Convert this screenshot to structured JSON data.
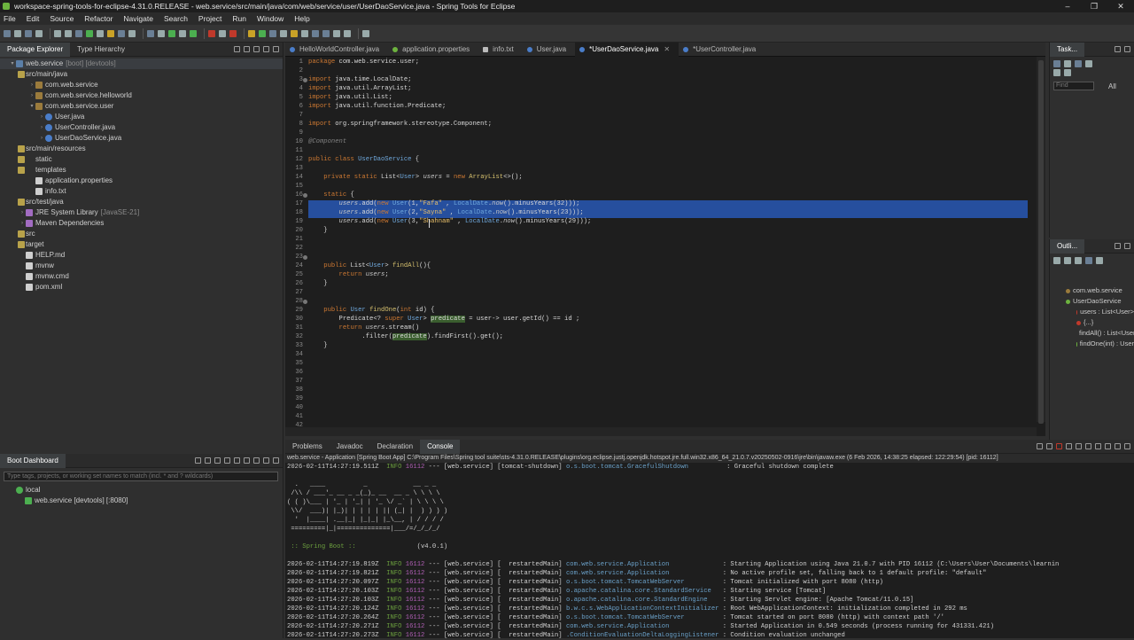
{
  "window": {
    "title": "workspace-spring-tools-for-eclipse-4.31.0.RELEASE - web.service/src/main/java/com/web/service/user/UserDaoService.java - Spring Tools for Eclipse",
    "controls": [
      "–",
      "❐",
      "✕"
    ]
  },
  "menu": [
    "File",
    "Edit",
    "Source",
    "Refactor",
    "Navigate",
    "Search",
    "Project",
    "Run",
    "Window",
    "Help"
  ],
  "package_explorer": {
    "tabs": [
      "Package Explorer",
      "Type Hierarchy"
    ],
    "items": [
      {
        "label": "web.service",
        "deco": "[boot] [devtools]",
        "icon": "proj",
        "indent": 0,
        "tw": "▾"
      },
      {
        "label": "src/main/java",
        "deco": "",
        "icon": "fold",
        "indent": 1,
        "tw": "▾"
      },
      {
        "label": "com.web.service",
        "deco": "",
        "icon": "pkg",
        "indent": 2,
        "tw": "›"
      },
      {
        "label": "com.web.service.helloworld",
        "deco": "",
        "icon": "pkg",
        "indent": 2,
        "tw": "›"
      },
      {
        "label": "com.web.service.user",
        "deco": "",
        "icon": "pkg",
        "indent": 2,
        "tw": "▾"
      },
      {
        "label": "User.java",
        "deco": "",
        "icon": "java",
        "indent": 3,
        "tw": "›"
      },
      {
        "label": "UserController.java",
        "deco": "",
        "icon": "java",
        "indent": 3,
        "tw": "›"
      },
      {
        "label": "UserDaoService.java",
        "deco": "",
        "icon": "java",
        "indent": 3,
        "tw": "›"
      },
      {
        "label": "src/main/resources",
        "deco": "",
        "icon": "fold",
        "indent": 1,
        "tw": "▾"
      },
      {
        "label": "static",
        "deco": "",
        "icon": "fold",
        "indent": 2,
        "tw": ""
      },
      {
        "label": "templates",
        "deco": "",
        "icon": "fold",
        "indent": 2,
        "tw": ""
      },
      {
        "label": "application.properties",
        "deco": "",
        "icon": "file",
        "indent": 2,
        "tw": ""
      },
      {
        "label": "info.txt",
        "deco": "",
        "icon": "file",
        "indent": 2,
        "tw": ""
      },
      {
        "label": "src/test/java",
        "deco": "",
        "icon": "fold",
        "indent": 1,
        "tw": "›"
      },
      {
        "label": "JRE System Library",
        "deco": "[JavaSE-21]",
        "icon": "jar",
        "indent": 1,
        "tw": "›"
      },
      {
        "label": "Maven Dependencies",
        "deco": "",
        "icon": "jar",
        "indent": 1,
        "tw": "›"
      },
      {
        "label": "src",
        "deco": "",
        "icon": "fold",
        "indent": 1,
        "tw": "›"
      },
      {
        "label": "target",
        "deco": "",
        "icon": "fold",
        "indent": 1,
        "tw": ""
      },
      {
        "label": "HELP.md",
        "deco": "",
        "icon": "file",
        "indent": 1,
        "tw": ""
      },
      {
        "label": "mvnw",
        "deco": "",
        "icon": "file",
        "indent": 1,
        "tw": ""
      },
      {
        "label": "mvnw.cmd",
        "deco": "",
        "icon": "file",
        "indent": 1,
        "tw": ""
      },
      {
        "label": "pom.xml",
        "deco": "",
        "icon": "file",
        "indent": 1,
        "tw": ""
      }
    ]
  },
  "editor": {
    "tabs": [
      {
        "label": "HelloWorldController.java",
        "kind": "java",
        "active": false
      },
      {
        "label": "application.properties",
        "kind": "prop",
        "active": false
      },
      {
        "label": "info.txt",
        "kind": "txt",
        "active": false
      },
      {
        "label": "User.java",
        "kind": "java",
        "active": false
      },
      {
        "label": "*UserDaoService.java",
        "kind": "java",
        "active": true
      },
      {
        "label": "*UserController.java",
        "kind": "java",
        "active": false
      }
    ],
    "lines": [
      "<span class='k'>package</span> com.web.service.user;",
      "",
      "<span class='k'>import</span> java.time.LocalDate;",
      "<span class='k'>import</span> java.util.ArrayList;",
      "<span class='k'>import</span> java.util.List;",
      "<span class='k'>import</span> java.util.function.Predicate;",
      "",
      "<span class='k'>import</span> org.springframework.stereotype.Component;",
      "",
      "<span class='an'>@Component</span>",
      "",
      "<span class='k'>public class</span> <span class='t'>UserDaoService</span> {",
      "",
      "    <span class='k'>private static</span> List&lt;<span class='t'>User</span>&gt; <span class='it'>users</span> = <span class='k'>new</span> <span class='f'>ArrayList</span>&lt;&gt;();",
      "",
      "    <span class='k'>static</span> {",
      "        <span class='it'>users</span>.add(<span class='k'>new</span> <span class='t'>User</span>(1,<span class='s'>\"Fafa\"</span> , <span class='t'>LocalDate</span>.<span class='it'>now</span>().minusYears(32)));",
      "        <span class='it'>users</span>.add(<span class='k'>new</span> <span class='t'>User</span>(2,<span class='s'>\"Sayna\"</span> , <span class='t'>LocalDate</span>.<span class='it'>now</span>().minusYears(23)));",
      "        <span class='it'>users</span>.add(<span class='k'>new</span> <span class='t'>User</span>(3,<span class='s'>\"Shahnam\"</span> , <span class='t'>LocalDate</span>.<span class='it'>now</span>().minusYears(29)));",
      "    }",
      "",
      "",
      "",
      "    <span class='k'>public</span> List&lt;<span class='t'>User</span>&gt; <span class='f'>findAll</span>(){",
      "        <span class='k'>return</span> <span class='it'>users</span>;",
      "    }",
      "",
      "",
      "    <span class='k'>public</span> <span class='t'>User</span> <span class='f'>findOne</span>(<span class='k'>int</span> id) {",
      "        Predicate&lt;? <span class='k'>super</span> <span class='t'>User</span>&gt; <span class='mark'>predicate</span> = user-&gt; user.getId() == id ;",
      "        <span class='k'>return</span> <span class='it'>users</span>.stream()",
      "              .filter(<span class='mark'>predicate</span>).findFirst().get();",
      "    }",
      "",
      "",
      "",
      "",
      "",
      "",
      "",
      "",
      ""
    ]
  },
  "tasks": {
    "tab": "Task...",
    "find_placeholder": "Find",
    "all_label": "All"
  },
  "outline": {
    "tab": "Outli...",
    "items": [
      {
        "label": "com.web.service",
        "color": "#9b7b3c",
        "indent": 0
      },
      {
        "label": "UserDaoService",
        "color": "#6db33f",
        "indent": 0
      },
      {
        "label": "users : List<User>",
        "color": "#c0392b",
        "indent": 1
      },
      {
        "label": "{...}",
        "color": "#c0392b",
        "indent": 1
      },
      {
        "label": "findAll() : List<User>",
        "color": "#6db33f",
        "indent": 1
      },
      {
        "label": "findOne(int) : User",
        "color": "#6db33f",
        "indent": 1
      }
    ]
  },
  "boot": {
    "tab": "Boot Dashboard",
    "search_placeholder": "Type tags, projects, or working set names to match (incl. * and ? wildcards)",
    "local": "local",
    "app": "web.service [devtools] [:8080]"
  },
  "console": {
    "tabs": [
      "Problems",
      "Javadoc",
      "Declaration",
      "Console"
    ],
    "path": "web.service - Application [Spring Boot App] C:\\Program Files\\Spring tool suite\\sts-4.31.0.RELEASE\\plugins\\org.eclipse.justj.openjdk.hotspot.jre.full.win32.x86_64_21.0.7.v20250502-0916\\jre\\bin\\javaw.exe (6 Feb 2026, 14:38:25 elapsed: 122:29:54) [pid: 16112]",
    "lines": [
      "<span class='ts'>2026-02-11T14:27:19.511Z</span>  <span class='info'>INFO</span> <span class='pid'>16112</span> --- [web.service] [tomcat-shutdown] <span class='lg'>o.s.boot.tomcat.GracefulShutdown</span>          : Graceful shutdown complete",
      "",
      "<span class='banner'>  .   ____          _            __ _ _</span>",
      "<span class='banner'> /\\\\ / ___'_ __ _ _(_)_ __  __ _ \\ \\ \\ \\</span>",
      "<span class='banner'>( ( )\\___ | '_ | '_| | '_ \\/ _` | \\ \\ \\ \\</span>",
      "<span class='banner'> \\\\/  ___)| |_)| | | | | || (_| |  ) ) ) )</span>",
      "<span class='banner'>  '  |____| .__|_| |_|_| |_\\__, | / / / /</span>",
      "<span class='banner'> =========|_|==============|___/=/_/_/_/</span>",
      "",
      "<span class='sb'> :: Spring Boot ::</span>                (v4.0.1)",
      "",
      "<span class='ts'>2026-02-11T14:27:19.819Z</span>  <span class='info'>INFO</span> <span class='pid'>16112</span> --- [web.service] [  restartedMain] <span class='lg'>com.web.service.Application</span>              : Starting Application using Java 21.0.7 with PID 16112 (C:\\Users\\User\\Documents\\learnin",
      "<span class='ts'>2026-02-11T14:27:19.821Z</span>  <span class='info'>INFO</span> <span class='pid'>16112</span> --- [web.service] [  restartedMain] <span class='lg'>com.web.service.Application</span>              : No active profile set, falling back to 1 default profile: \"default\"",
      "<span class='ts'>2026-02-11T14:27:20.097Z</span>  <span class='info'>INFO</span> <span class='pid'>16112</span> --- [web.service] [  restartedMain] <span class='lg'>o.s.boot.tomcat.TomcatWebServer</span>          : Tomcat initialized with port 8080 (http)",
      "<span class='ts'>2026-02-11T14:27:20.103Z</span>  <span class='info'>INFO</span> <span class='pid'>16112</span> --- [web.service] [  restartedMain] <span class='lg'>o.apache.catalina.core.StandardService</span>   : Starting service [Tomcat]",
      "<span class='ts'>2026-02-11T14:27:20.103Z</span>  <span class='info'>INFO</span> <span class='pid'>16112</span> --- [web.service] [  restartedMain] <span class='lg'>o.apache.catalina.core.StandardEngine</span>    : Starting Servlet engine: [Apache Tomcat/11.0.15]",
      "<span class='ts'>2026-02-11T14:27:20.124Z</span>  <span class='info'>INFO</span> <span class='pid'>16112</span> --- [web.service] [  restartedMain] <span class='lg'>b.w.c.s.WebApplicationContextInitializer</span> : Root WebApplicationContext: initialization completed in 292 ms",
      "<span class='ts'>2026-02-11T14:27:20.264Z</span>  <span class='info'>INFO</span> <span class='pid'>16112</span> --- [web.service] [  restartedMain] <span class='lg'>o.s.boot.tomcat.TomcatWebServer</span>          : Tomcat started on port 8080 (http) with context path '/'",
      "<span class='ts'>2026-02-11T14:27:20.271Z</span>  <span class='info'>INFO</span> <span class='pid'>16112</span> --- [web.service] [  restartedMain] <span class='lg'>com.web.service.Application</span>              : Started Application in 0.549 seconds (process running for 431331.421)",
      "<span class='ts'>2026-02-11T14:27:20.273Z</span>  <span class='info'>INFO</span> <span class='pid'>16112</span> --- [web.service] [  restartedMain] <span class='lg'>.ConditionEvaluationDeltaLoggingListener</span> : Condition evaluation unchanged"
    ]
  }
}
